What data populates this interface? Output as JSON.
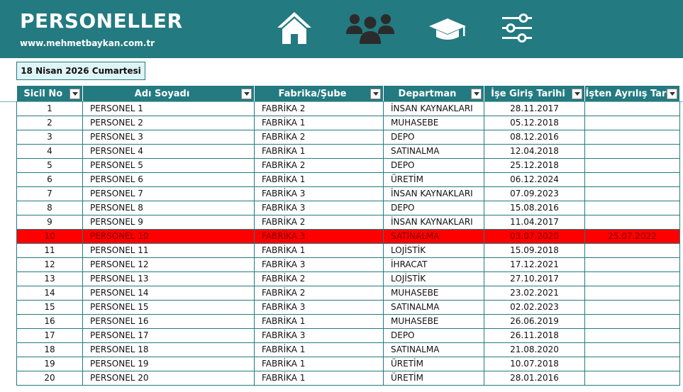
{
  "header": {
    "title": "PERSONELLER",
    "url": "www.mehmetbaykan.com.tr",
    "bg_color": "#237a80",
    "nav_icons": [
      "home-icon",
      "users-icon",
      "graduation-cap-icon",
      "sliders-icon"
    ]
  },
  "date_label": "18 Nisan 2026 Cumartesi",
  "table": {
    "columns": [
      "Sicil No",
      "Adı Soyadı",
      "Fabrika/Şube",
      "Departman",
      "İşe Giriş Tarihi",
      "İşten Ayrılış Tar"
    ],
    "highlight_color": "#ff0000",
    "rows": [
      [
        "1",
        "PERSONEL 1",
        "FABRİKA 2",
        "İNSAN KAYNAKLARI",
        "28.11.2017",
        ""
      ],
      [
        "2",
        "PERSONEL 2",
        "FABRİKA 1",
        "MUHASEBE",
        "05.12.2018",
        ""
      ],
      [
        "3",
        "PERSONEL 3",
        "FABRİKA 2",
        "DEPO",
        "08.12.2016",
        ""
      ],
      [
        "4",
        "PERSONEL 4",
        "FABRİKA 1",
        "SATINALMA",
        "12.04.2018",
        ""
      ],
      [
        "5",
        "PERSONEL 5",
        "FABRİKA 2",
        "DEPO",
        "25.12.2018",
        ""
      ],
      [
        "6",
        "PERSONEL 6",
        "FABRİKA 1",
        "ÜRETİM",
        "06.12.2024",
        ""
      ],
      [
        "7",
        "PERSONEL 7",
        "FABRİKA 3",
        "İNSAN KAYNAKLARI",
        "07.09.2023",
        ""
      ],
      [
        "8",
        "PERSONEL 8",
        "FABRİKA 3",
        "DEPO",
        "15.08.2016",
        ""
      ],
      [
        "9",
        "PERSONEL 9",
        "FABRİKA 2",
        "İNSAN KAYNAKLARI",
        "11.04.2017",
        ""
      ],
      [
        "10",
        "PERSONEL 10",
        "FABRİKA 3",
        "SATINALMA",
        "03.07.2020",
        "25.07.2022"
      ],
      [
        "11",
        "PERSONEL 11",
        "FABRİKA 1",
        "LOJİSTİK",
        "15.09.2018",
        ""
      ],
      [
        "12",
        "PERSONEL 12",
        "FABRİKA 3",
        "İHRACAT",
        "17.12.2021",
        ""
      ],
      [
        "13",
        "PERSONEL 13",
        "FABRİKA 2",
        "LOJİSTİK",
        "27.10.2017",
        ""
      ],
      [
        "14",
        "PERSONEL 14",
        "FABRİKA 2",
        "MUHASEBE",
        "23.02.2021",
        ""
      ],
      [
        "15",
        "PERSONEL 15",
        "FABRİKA 3",
        "SATINALMA",
        "02.02.2023",
        ""
      ],
      [
        "16",
        "PERSONEL 16",
        "FABRİKA 1",
        "MUHASEBE",
        "26.06.2019",
        ""
      ],
      [
        "17",
        "PERSONEL 17",
        "FABRİKA 3",
        "DEPO",
        "26.11.2018",
        ""
      ],
      [
        "18",
        "PERSONEL 18",
        "FABRİKA 1",
        "SATINALMA",
        "21.08.2020",
        ""
      ],
      [
        "19",
        "PERSONEL 19",
        "FABRİKA 1",
        "ÜRETİM",
        "10.07.2018",
        ""
      ],
      [
        "20",
        "PERSONEL 20",
        "FABRİKA 1",
        "ÜRETİM",
        "28.01.2016",
        ""
      ]
    ]
  }
}
